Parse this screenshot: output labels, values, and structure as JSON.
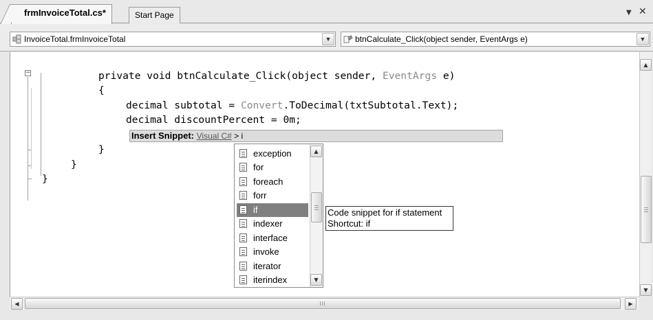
{
  "tabs": [
    {
      "label": "frmInvoiceTotal.cs*",
      "active": true
    },
    {
      "label": "Start Page",
      "active": false
    }
  ],
  "tab_controls": {
    "dropdown_icon": "chevron-down-icon",
    "close_icon": "close-icon"
  },
  "navbar": {
    "class_combo": "InvoiceTotal.frmInvoiceTotal",
    "member_combo": "btnCalculate_Click(object sender, EventArgs e)"
  },
  "code": {
    "line1_prefix": "private void btnCalculate_Click(object sender, ",
    "line1_type": "EventArgs",
    "line1_suffix": " e)",
    "line2": "{",
    "line3_prefix": "decimal subtotal = ",
    "line3_type": "Convert",
    "line3_suffix": ".ToDecimal(txtSubtotal.Text);",
    "line4": "decimal discountPercent = 0m;",
    "line6": "}",
    "line7": "}",
    "line8": "}"
  },
  "snippet_bar": {
    "label": "Insert Snippet:",
    "path_link": "Visual C#",
    "separator": " > ",
    "typed": "i"
  },
  "completion_list": {
    "items": [
      "exception",
      "for",
      "foreach",
      "forr",
      "if",
      "indexer",
      "interface",
      "invoke",
      "iterator",
      "iterindex"
    ],
    "selected": "if"
  },
  "tooltip": {
    "line1": "Code snippet for if statement",
    "line2": "Shortcut: if"
  },
  "colors": {
    "type_name": "#8a8a8a",
    "selection": "#808080"
  }
}
